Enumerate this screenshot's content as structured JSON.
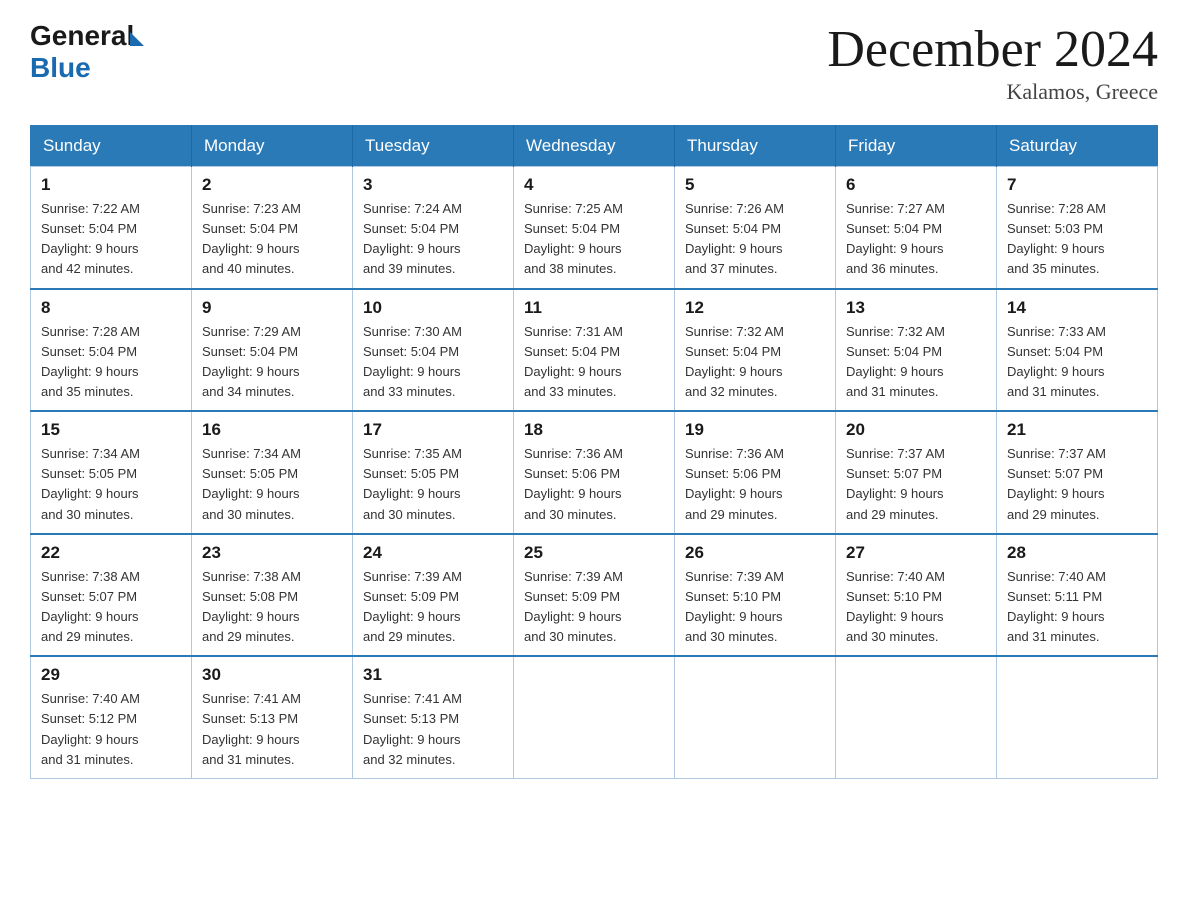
{
  "logo": {
    "text_general": "General",
    "text_blue": "Blue"
  },
  "title": "December 2024",
  "subtitle": "Kalamos, Greece",
  "days_of_week": [
    "Sunday",
    "Monday",
    "Tuesday",
    "Wednesday",
    "Thursday",
    "Friday",
    "Saturday"
  ],
  "weeks": [
    [
      {
        "day": "1",
        "sunrise": "7:22 AM",
        "sunset": "5:04 PM",
        "daylight": "9 hours and 42 minutes."
      },
      {
        "day": "2",
        "sunrise": "7:23 AM",
        "sunset": "5:04 PM",
        "daylight": "9 hours and 40 minutes."
      },
      {
        "day": "3",
        "sunrise": "7:24 AM",
        "sunset": "5:04 PM",
        "daylight": "9 hours and 39 minutes."
      },
      {
        "day": "4",
        "sunrise": "7:25 AM",
        "sunset": "5:04 PM",
        "daylight": "9 hours and 38 minutes."
      },
      {
        "day": "5",
        "sunrise": "7:26 AM",
        "sunset": "5:04 PM",
        "daylight": "9 hours and 37 minutes."
      },
      {
        "day": "6",
        "sunrise": "7:27 AM",
        "sunset": "5:04 PM",
        "daylight": "9 hours and 36 minutes."
      },
      {
        "day": "7",
        "sunrise": "7:28 AM",
        "sunset": "5:03 PM",
        "daylight": "9 hours and 35 minutes."
      }
    ],
    [
      {
        "day": "8",
        "sunrise": "7:28 AM",
        "sunset": "5:04 PM",
        "daylight": "9 hours and 35 minutes."
      },
      {
        "day": "9",
        "sunrise": "7:29 AM",
        "sunset": "5:04 PM",
        "daylight": "9 hours and 34 minutes."
      },
      {
        "day": "10",
        "sunrise": "7:30 AM",
        "sunset": "5:04 PM",
        "daylight": "9 hours and 33 minutes."
      },
      {
        "day": "11",
        "sunrise": "7:31 AM",
        "sunset": "5:04 PM",
        "daylight": "9 hours and 33 minutes."
      },
      {
        "day": "12",
        "sunrise": "7:32 AM",
        "sunset": "5:04 PM",
        "daylight": "9 hours and 32 minutes."
      },
      {
        "day": "13",
        "sunrise": "7:32 AM",
        "sunset": "5:04 PM",
        "daylight": "9 hours and 31 minutes."
      },
      {
        "day": "14",
        "sunrise": "7:33 AM",
        "sunset": "5:04 PM",
        "daylight": "9 hours and 31 minutes."
      }
    ],
    [
      {
        "day": "15",
        "sunrise": "7:34 AM",
        "sunset": "5:05 PM",
        "daylight": "9 hours and 30 minutes."
      },
      {
        "day": "16",
        "sunrise": "7:34 AM",
        "sunset": "5:05 PM",
        "daylight": "9 hours and 30 minutes."
      },
      {
        "day": "17",
        "sunrise": "7:35 AM",
        "sunset": "5:05 PM",
        "daylight": "9 hours and 30 minutes."
      },
      {
        "day": "18",
        "sunrise": "7:36 AM",
        "sunset": "5:06 PM",
        "daylight": "9 hours and 30 minutes."
      },
      {
        "day": "19",
        "sunrise": "7:36 AM",
        "sunset": "5:06 PM",
        "daylight": "9 hours and 29 minutes."
      },
      {
        "day": "20",
        "sunrise": "7:37 AM",
        "sunset": "5:07 PM",
        "daylight": "9 hours and 29 minutes."
      },
      {
        "day": "21",
        "sunrise": "7:37 AM",
        "sunset": "5:07 PM",
        "daylight": "9 hours and 29 minutes."
      }
    ],
    [
      {
        "day": "22",
        "sunrise": "7:38 AM",
        "sunset": "5:07 PM",
        "daylight": "9 hours and 29 minutes."
      },
      {
        "day": "23",
        "sunrise": "7:38 AM",
        "sunset": "5:08 PM",
        "daylight": "9 hours and 29 minutes."
      },
      {
        "day": "24",
        "sunrise": "7:39 AM",
        "sunset": "5:09 PM",
        "daylight": "9 hours and 29 minutes."
      },
      {
        "day": "25",
        "sunrise": "7:39 AM",
        "sunset": "5:09 PM",
        "daylight": "9 hours and 30 minutes."
      },
      {
        "day": "26",
        "sunrise": "7:39 AM",
        "sunset": "5:10 PM",
        "daylight": "9 hours and 30 minutes."
      },
      {
        "day": "27",
        "sunrise": "7:40 AM",
        "sunset": "5:10 PM",
        "daylight": "9 hours and 30 minutes."
      },
      {
        "day": "28",
        "sunrise": "7:40 AM",
        "sunset": "5:11 PM",
        "daylight": "9 hours and 31 minutes."
      }
    ],
    [
      {
        "day": "29",
        "sunrise": "7:40 AM",
        "sunset": "5:12 PM",
        "daylight": "9 hours and 31 minutes."
      },
      {
        "day": "30",
        "sunrise": "7:41 AM",
        "sunset": "5:13 PM",
        "daylight": "9 hours and 31 minutes."
      },
      {
        "day": "31",
        "sunrise": "7:41 AM",
        "sunset": "5:13 PM",
        "daylight": "9 hours and 32 minutes."
      },
      null,
      null,
      null,
      null
    ]
  ],
  "labels": {
    "sunrise_prefix": "Sunrise: ",
    "sunset_prefix": "Sunset: ",
    "daylight_prefix": "Daylight: "
  }
}
